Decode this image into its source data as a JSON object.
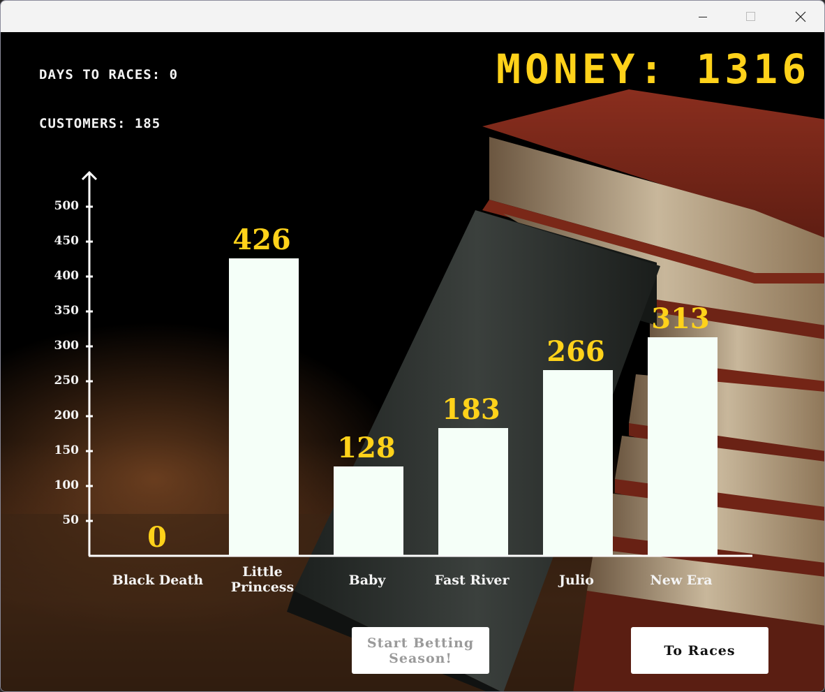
{
  "window": {
    "controls": [
      "minimize-icon",
      "maximize-icon",
      "close-icon"
    ]
  },
  "hud": {
    "days_to_races": "DAYS TO RACES: 0",
    "customers": "CUSTOMERS: 185",
    "money": "MONEY: 1316"
  },
  "colors": {
    "value_text": "#ffd21a",
    "bar_fill": "#f5fff8",
    "axis": "#ffffff",
    "label_text": "#f4f4f4"
  },
  "chart_data": {
    "type": "bar",
    "categories": [
      "Black Death",
      "Little\nPrincess",
      "Baby",
      "Fast River",
      "Julio",
      "New Era"
    ],
    "values": [
      0,
      426,
      128,
      183,
      266,
      313
    ],
    "value_labels": [
      "0",
      "426",
      "128",
      "183",
      "266",
      "313"
    ],
    "yticks": [
      "50",
      "100",
      "150",
      "200",
      "250",
      "300",
      "350",
      "400",
      "450",
      "500"
    ],
    "ylim": [
      0,
      550
    ],
    "grid": false,
    "legend": false
  },
  "buttons": {
    "start_betting": "Start Betting\nSeason!",
    "to_races": "To Races"
  }
}
